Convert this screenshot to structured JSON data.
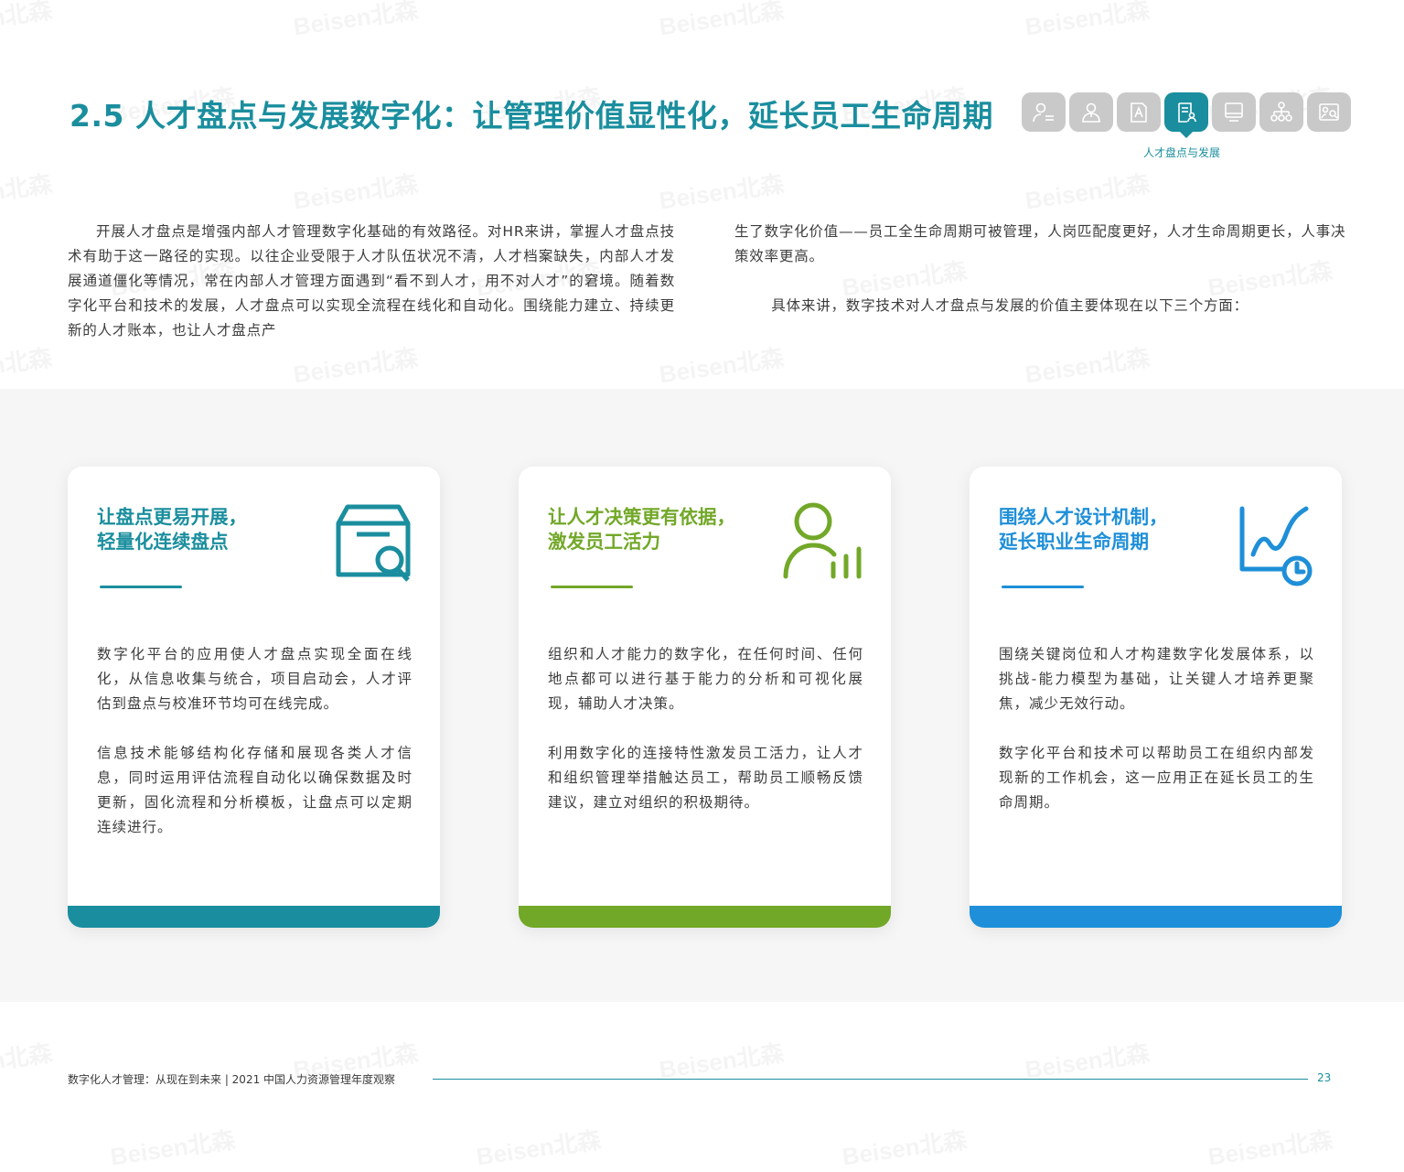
{
  "header": {
    "title": "2.5 人才盘点与发展数字化：让管理价值显性化，延长员工生命周期",
    "nav_icons": [
      "person-list-icon",
      "person-icon",
      "document-a-icon",
      "checklist-person-icon",
      "screen-icon",
      "org-chart-icon",
      "image-search-icon"
    ],
    "active_index": 3,
    "active_caption": "人才盘点与发展"
  },
  "intro": {
    "left": "开展人才盘点是增强内部人才管理数字化基础的有效路径。对HR来讲，掌握人才盘点技术有助于这一路径的实现。以往企业受限于人才队伍状况不清，人才档案缺失，内部人才发展通道僵化等情况，常在内部人才管理方面遇到“看不到人才，用不对人才”的窘境。随着数字化平台和技术的发展，人才盘点可以实现全流程在线化和自动化。围绕能力建立、持续更新的人才账本，也让人才盘点产",
    "right_p1": "生了数字化价值——员工全生命周期可被管理，人岗匹配度更好，人才生命周期更长，人事决策效率更高。",
    "right_p2": "具体来讲，数字技术对人才盘点与发展的价值主要体现在以下三个方面："
  },
  "cards": [
    {
      "heading_line1": "让盘点更易开展，",
      "heading_line2": "轻量化连续盘点",
      "icon": "box-search-icon",
      "color": "#1a8e9e",
      "p1": "数字化平台的应用使人才盘点实现全面在线化，从信息收集与统合，项目启动会，人才评估到盘点与校准环节均可在线完成。",
      "p2": "信息技术能够结构化存储和展现各类人才信息，同时运用评估流程自动化以确保数据及时更新，固化流程和分析模板，让盘点可以定期连续进行。"
    },
    {
      "heading_line1": "让人才决策更有依据，",
      "heading_line2": "激发员工活力",
      "icon": "person-chart-icon",
      "color": "#72a828",
      "p1": "组织和人才能力的数字化，在任何时间、任何地点都可以进行基于能力的分析和可视化展现，辅助人才决策。",
      "p2": "利用数字化的连接特性激发员工活力，让人才和组织管理举措触达员工，帮助员工顺畅反馈建议，建立对组织的积极期待。"
    },
    {
      "heading_line1": "围绕人才设计机制，",
      "heading_line2": "延长职业生命周期",
      "icon": "trend-clock-icon",
      "color": "#1e8fd8",
      "p1": "围绕关键岗位和人才构建数字化发展体系，以挑战-能力模型为基础，让关键人才培养更聚焦，减少无效行动。",
      "p2": "数字化平台和技术可以帮助员工在组织内部发现新的工作机会，这一应用正在延长员工的生命周期。"
    }
  ],
  "footer": {
    "text": "数字化人才管理：从现在到未来 | 2021 中国人力资源管理年度观察",
    "page_number": "23"
  },
  "watermark": "Beisen北森"
}
